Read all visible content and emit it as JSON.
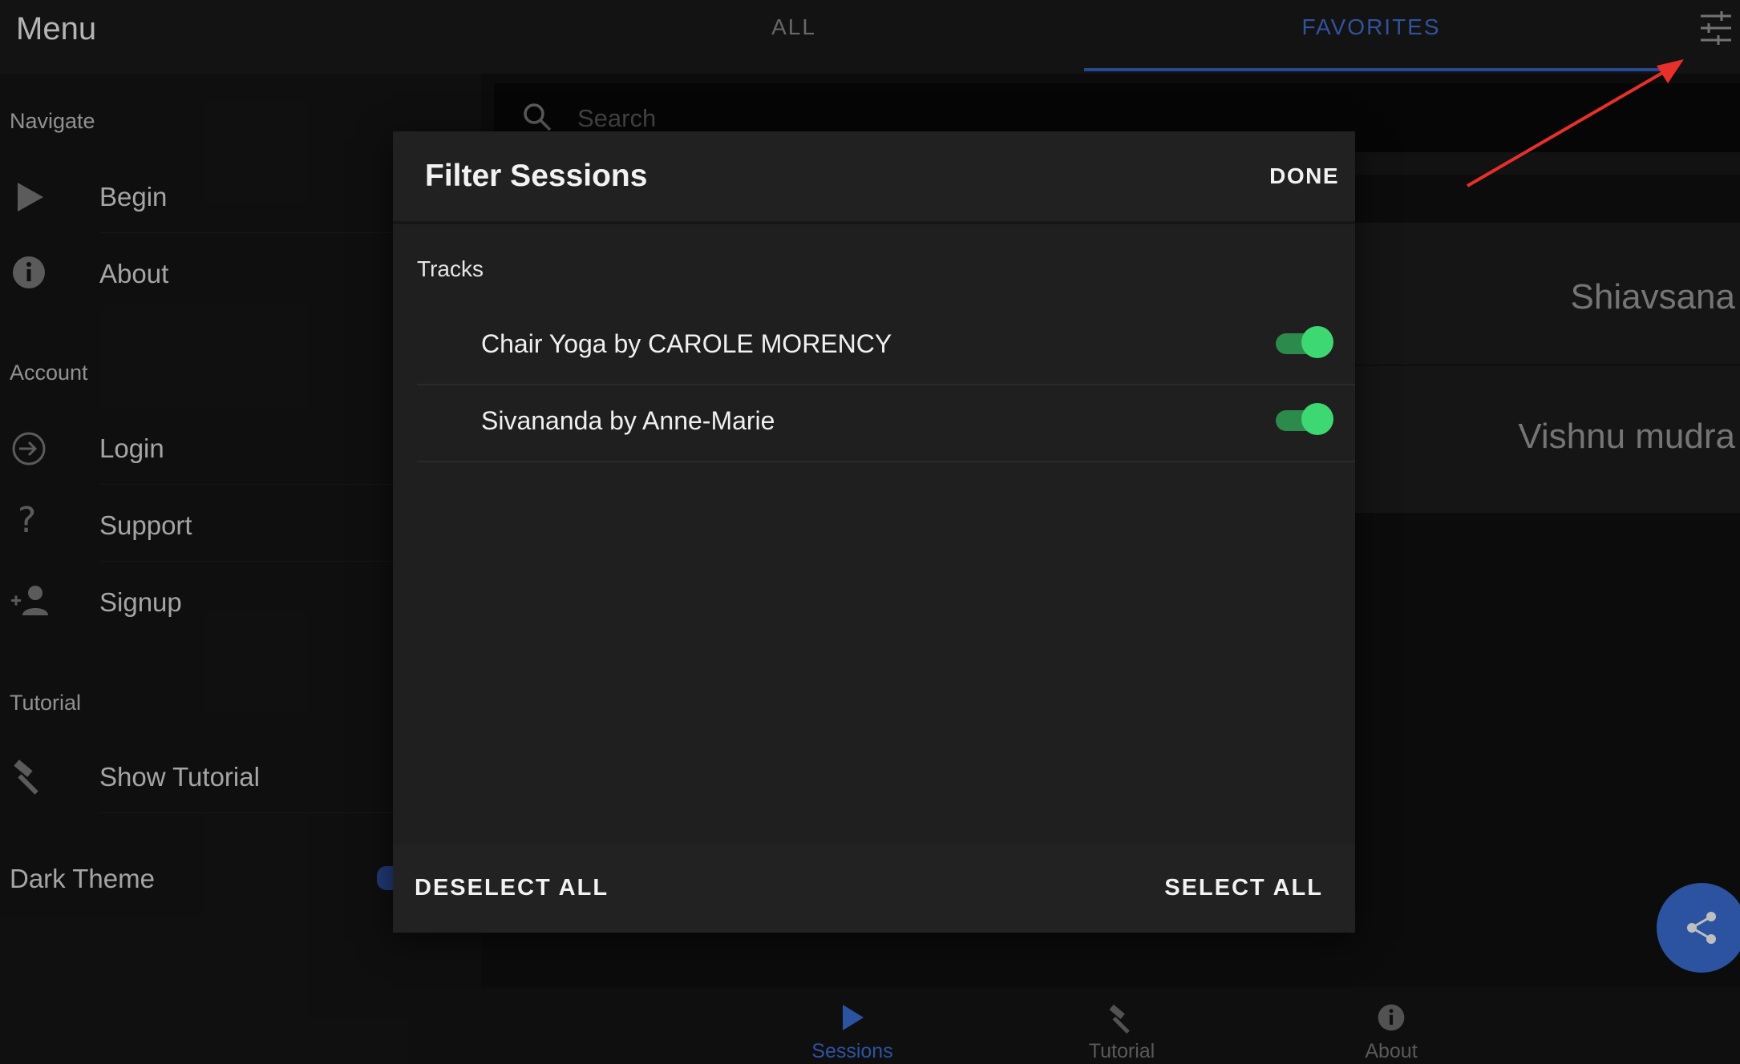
{
  "header": {
    "menu_title": "Menu",
    "tabs": [
      {
        "label": "ALL",
        "active": false
      },
      {
        "label": "FAVORITES",
        "active": true
      }
    ],
    "filter_icon": "sliders-icon"
  },
  "sidebar": {
    "sections": [
      {
        "label": "Navigate",
        "items": [
          {
            "label": "Begin",
            "icon": "play-icon"
          },
          {
            "label": "About",
            "icon": "info-icon"
          }
        ]
      },
      {
        "label": "Account",
        "items": [
          {
            "label": "Login",
            "icon": "login-icon"
          },
          {
            "label": "Support",
            "icon": "help-icon"
          },
          {
            "label": "Signup",
            "icon": "person-add-icon"
          }
        ]
      },
      {
        "label": "Tutorial",
        "items": [
          {
            "label": "Show Tutorial",
            "icon": "hammer-icon"
          }
        ]
      }
    ],
    "dark_theme_label": "Dark Theme"
  },
  "search": {
    "placeholder": "Search"
  },
  "sessions": [
    {
      "name": "Shiavsana"
    },
    {
      "name": "Vishnu mudra"
    }
  ],
  "modal": {
    "title": "Filter Sessions",
    "done_label": "DONE",
    "tracks_label": "Tracks",
    "tracks": [
      {
        "label": "Chair Yoga by CAROLE MORENCY",
        "enabled": true
      },
      {
        "label": "Sivananda by Anne-Marie",
        "enabled": true
      }
    ],
    "deselect_all_label": "DESELECT ALL",
    "select_all_label": "SELECT ALL"
  },
  "bottom_nav": [
    {
      "label": "Sessions",
      "icon": "play-icon",
      "active": true
    },
    {
      "label": "Tutorial",
      "icon": "hammer-icon",
      "active": false
    },
    {
      "label": "About",
      "icon": "info-icon",
      "active": false
    }
  ],
  "colors": {
    "accent": "#3b6fd6",
    "toggle_on": "#3ed873",
    "annotation_arrow": "#e8302a"
  }
}
